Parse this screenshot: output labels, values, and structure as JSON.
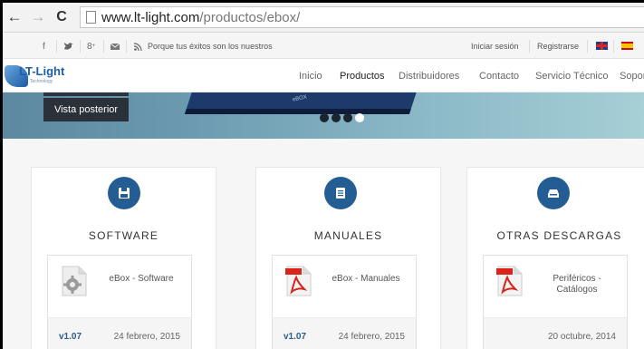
{
  "browser": {
    "url_host": "www.lt-light.com",
    "url_path": "/productos/ebox/"
  },
  "topbar": {
    "tagline": "Porque tus éxitos son los nuestros",
    "login": "Iniciar sesión",
    "register": "Registrarse",
    "icons": [
      "facebook-icon",
      "twitter-icon",
      "google-plus-icon",
      "email-icon",
      "rss-icon"
    ]
  },
  "logo": {
    "text": "LT-Light",
    "sub": "Technology"
  },
  "nav": {
    "items": [
      "Inicio",
      "Productos",
      "Distribuidores",
      "Contacto",
      "Servicio Técnico",
      "Sopor"
    ],
    "active": "Productos"
  },
  "hero": {
    "button": "Vista posterior",
    "device_label": "eBOX",
    "slides": 4,
    "active_slide": 4
  },
  "sections": [
    {
      "title": "SOFTWARE",
      "icon": "save-icon",
      "item": {
        "name": "eBox - Software",
        "version": "v1.07",
        "date": "24 febrero, 2015",
        "icon": "gear-file-icon"
      }
    },
    {
      "title": "MANUALES",
      "icon": "document-icon",
      "item": {
        "name": "eBox - Manuales",
        "version": "v1.07",
        "date": "24 febrero, 2015",
        "icon": "pdf-icon"
      }
    },
    {
      "title": "OTRAS DESCARGAS",
      "icon": "download-tray-icon",
      "item": {
        "name": "Periféricos - Catálogos",
        "version": "",
        "date": "20 octubre, 2014",
        "icon": "pdf-icon"
      }
    }
  ],
  "colors": {
    "accent": "#245d94",
    "version": "#2b5d8e"
  }
}
